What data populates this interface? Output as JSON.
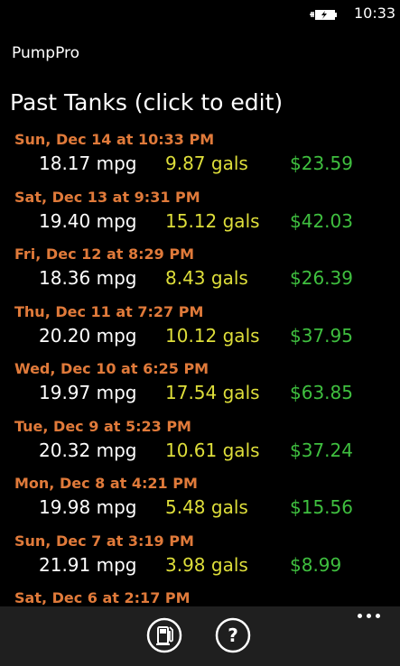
{
  "status": {
    "time": "10:33",
    "battery_icon": "battery-charging-icon"
  },
  "app": {
    "name": "PumpPro"
  },
  "page": {
    "title": "Past Tanks (click to edit)"
  },
  "colors": {
    "date": "#e07a3a",
    "mpg": "#ffffff",
    "gallons": "#dede3a",
    "cost": "#3fbf3f",
    "app_bar": "#1f1f1f"
  },
  "tanks": [
    {
      "date": "Sun, Dec 14 at 10:33 PM",
      "mpg": "18.17 mpg",
      "gals": "9.87 gals",
      "cost": "$23.59"
    },
    {
      "date": "Sat, Dec 13 at 9:31 PM",
      "mpg": "19.40 mpg",
      "gals": "15.12 gals",
      "cost": "$42.03"
    },
    {
      "date": "Fri, Dec 12 at 8:29 PM",
      "mpg": "18.36 mpg",
      "gals": "8.43 gals",
      "cost": "$26.39"
    },
    {
      "date": "Thu, Dec 11 at 7:27 PM",
      "mpg": "20.20 mpg",
      "gals": "10.12 gals",
      "cost": "$37.95"
    },
    {
      "date": "Wed, Dec 10 at 6:25 PM",
      "mpg": "19.97 mpg",
      "gals": "17.54 gals",
      "cost": "$63.85"
    },
    {
      "date": "Tue, Dec 9 at 5:23 PM",
      "mpg": "20.32 mpg",
      "gals": "10.61 gals",
      "cost": "$37.24"
    },
    {
      "date": "Mon, Dec 8 at 4:21 PM",
      "mpg": "19.98 mpg",
      "gals": "5.48 gals",
      "cost": "$15.56"
    },
    {
      "date": "Sun, Dec 7 at 3:19 PM",
      "mpg": "21.91 mpg",
      "gals": "3.98 gals",
      "cost": "$8.99"
    },
    {
      "date": "Sat, Dec 6 at 2:17 PM",
      "mpg": "",
      "gals": "",
      "cost": ""
    }
  ],
  "app_bar": {
    "buttons": [
      {
        "icon": "gas-pump-icon"
      },
      {
        "icon": "help-icon",
        "glyph": "?"
      }
    ],
    "more_icon": "ellipsis-icon"
  }
}
